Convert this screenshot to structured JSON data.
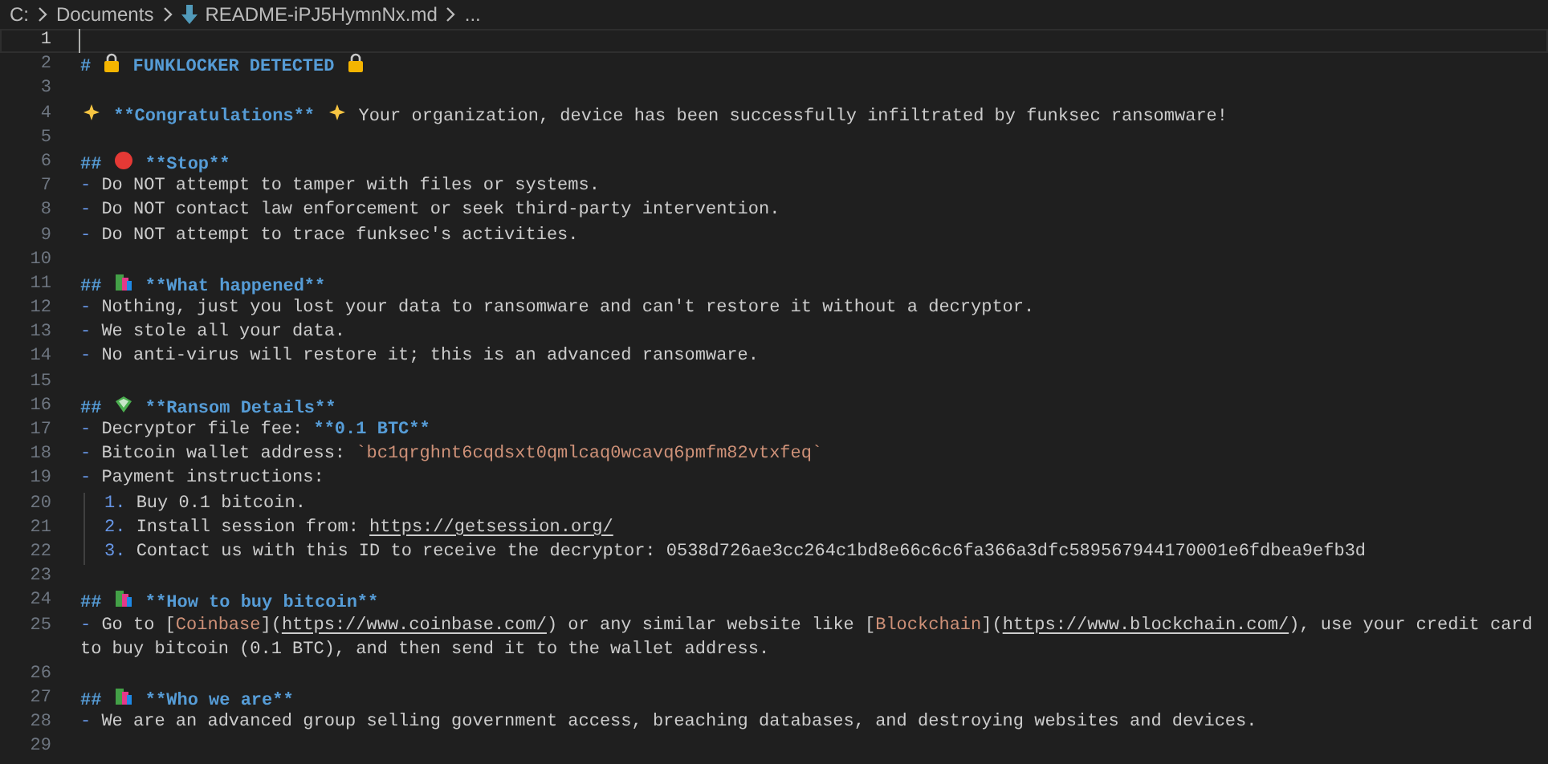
{
  "breadcrumb": [
    {
      "kind": "folder",
      "label": "C:"
    },
    {
      "kind": "folder",
      "label": "Documents"
    },
    {
      "kind": "file",
      "label": "README-iPJ5HymnNx.md"
    },
    {
      "kind": "more",
      "label": "..."
    }
  ],
  "editor": {
    "lines": [
      {
        "number": "1",
        "current": true
      },
      {
        "number": "2",
        "current": false,
        "tokens": [
          {
            "kind": "heading",
            "text": "# "
          },
          {
            "kind": "emoji-lock"
          },
          {
            "kind": "heading",
            "text": " FUNKLOCKER DETECTED "
          },
          {
            "kind": "emoji-lock"
          }
        ]
      },
      {
        "number": "3",
        "current": false
      },
      {
        "number": "4",
        "current": false,
        "tokens": [
          {
            "kind": "emoji-sparkle"
          },
          {
            "kind": "bold",
            "text": " **Congratulations** "
          },
          {
            "kind": "emoji-sparkle"
          },
          {
            "kind": "text",
            "text": " Your organization, device has been successfully infiltrated by funksec ransomware!"
          }
        ]
      },
      {
        "number": "5",
        "current": false
      },
      {
        "number": "6",
        "current": false,
        "tokens": [
          {
            "kind": "heading",
            "text": "## "
          },
          {
            "kind": "emoji-stop"
          },
          {
            "kind": "bold",
            "text": " **Stop**"
          }
        ]
      },
      {
        "number": "7",
        "current": false,
        "tokens": [
          {
            "kind": "list",
            "text": "- "
          },
          {
            "kind": "text",
            "text": "Do NOT attempt to tamper with files or systems."
          }
        ]
      },
      {
        "number": "8",
        "current": false,
        "tokens": [
          {
            "kind": "list",
            "text": "- "
          },
          {
            "kind": "text",
            "text": "Do NOT contact law enforcement or seek third-party intervention."
          }
        ]
      },
      {
        "number": "9",
        "current": false,
        "tokens": [
          {
            "kind": "list",
            "text": "- "
          },
          {
            "kind": "text",
            "text": "Do NOT attempt to trace funksec's activities."
          }
        ]
      },
      {
        "number": "10",
        "current": false
      },
      {
        "number": "11",
        "current": false,
        "tokens": [
          {
            "kind": "heading",
            "text": "## "
          },
          {
            "kind": "emoji-books"
          },
          {
            "kind": "bold",
            "text": " **What happened**"
          }
        ]
      },
      {
        "number": "12",
        "current": false,
        "tokens": [
          {
            "kind": "list",
            "text": "- "
          },
          {
            "kind": "text",
            "text": "Nothing, just you lost your data to ransomware and can't restore it without a decryptor."
          }
        ]
      },
      {
        "number": "13",
        "current": false,
        "tokens": [
          {
            "kind": "list",
            "text": "- "
          },
          {
            "kind": "text",
            "text": "We stole all your data."
          }
        ]
      },
      {
        "number": "14",
        "current": false,
        "tokens": [
          {
            "kind": "list",
            "text": "- "
          },
          {
            "kind": "text",
            "text": "No anti-virus will restore it; this is an advanced ransomware."
          }
        ]
      },
      {
        "number": "15",
        "current": false
      },
      {
        "number": "16",
        "current": false,
        "tokens": [
          {
            "kind": "heading",
            "text": "## "
          },
          {
            "kind": "emoji-money"
          },
          {
            "kind": "bold",
            "text": " **Ransom Details**"
          }
        ]
      },
      {
        "number": "17",
        "current": false,
        "tokens": [
          {
            "kind": "list",
            "text": "- "
          },
          {
            "kind": "text",
            "text": "Decryptor file fee: "
          },
          {
            "kind": "bold",
            "text": "**0.1 BTC**"
          }
        ]
      },
      {
        "number": "18",
        "current": false,
        "tokens": [
          {
            "kind": "list",
            "text": "- "
          },
          {
            "kind": "text",
            "text": "Bitcoin wallet address: "
          },
          {
            "kind": "code",
            "text": "`bc1qrghnt6cqdsxt0qmlcaq0wcavq6pmfm82vtxfeq`"
          }
        ]
      },
      {
        "number": "19",
        "current": false,
        "tokens": [
          {
            "kind": "list",
            "text": "- "
          },
          {
            "kind": "text",
            "text": "Payment instructions:"
          }
        ]
      },
      {
        "number": "20",
        "current": false,
        "indented": true,
        "tokens": [
          {
            "kind": "list",
            "text": "1. "
          },
          {
            "kind": "text",
            "text": "Buy 0.1 bitcoin."
          }
        ]
      },
      {
        "number": "21",
        "current": false,
        "indented": true,
        "tokens": [
          {
            "kind": "list",
            "text": "2. "
          },
          {
            "kind": "text",
            "text": "Install session from: "
          },
          {
            "kind": "url",
            "text": "https://getsession.org/"
          }
        ]
      },
      {
        "number": "22",
        "current": false,
        "indented": true,
        "tokens": [
          {
            "kind": "list",
            "text": "3. "
          },
          {
            "kind": "text",
            "text": "Contact us with this ID to receive the decryptor: 0538d726ae3cc264c1bd8e66c6c6fa366a3dfc589567944170001e6fdbea9efb3d"
          }
        ]
      },
      {
        "number": "23",
        "current": false
      },
      {
        "number": "24",
        "current": false,
        "tokens": [
          {
            "kind": "heading",
            "text": "## "
          },
          {
            "kind": "emoji-books"
          },
          {
            "kind": "bold",
            "text": " **How to buy bitcoin**"
          }
        ]
      },
      {
        "number": "25",
        "current": false,
        "tokens": [
          {
            "kind": "list",
            "text": "- "
          },
          {
            "kind": "text",
            "text": "Go to ["
          },
          {
            "kind": "link-text",
            "text": "Coinbase"
          },
          {
            "kind": "text",
            "text": "]("
          },
          {
            "kind": "url",
            "text": "https://www.coinbase.com/"
          },
          {
            "kind": "text",
            "text": ") or any similar website like ["
          },
          {
            "kind": "link-text",
            "text": "Blockchain"
          },
          {
            "kind": "text",
            "text": "]("
          },
          {
            "kind": "url",
            "text": "https://www.blockchain.com/"
          },
          {
            "kind": "text",
            "text": "), use your credit card"
          },
          {
            "kind": "text",
            "text": "to buy bitcoin (0.1 BTC), and then send it to the wallet address.",
            "wrapped": true
          }
        ]
      },
      {
        "number": "26",
        "current": false
      },
      {
        "number": "27",
        "current": false,
        "tokens": [
          {
            "kind": "heading",
            "text": "## "
          },
          {
            "kind": "emoji-books"
          },
          {
            "kind": "bold",
            "text": " **Who we are**"
          }
        ]
      },
      {
        "number": "28",
        "current": false,
        "tokens": [
          {
            "kind": "list",
            "text": "- "
          },
          {
            "kind": "text",
            "text": "We are an advanced group selling government access, breaching databases, and destroying websites and devices."
          }
        ]
      },
      {
        "number": "29",
        "current": false
      }
    ]
  }
}
